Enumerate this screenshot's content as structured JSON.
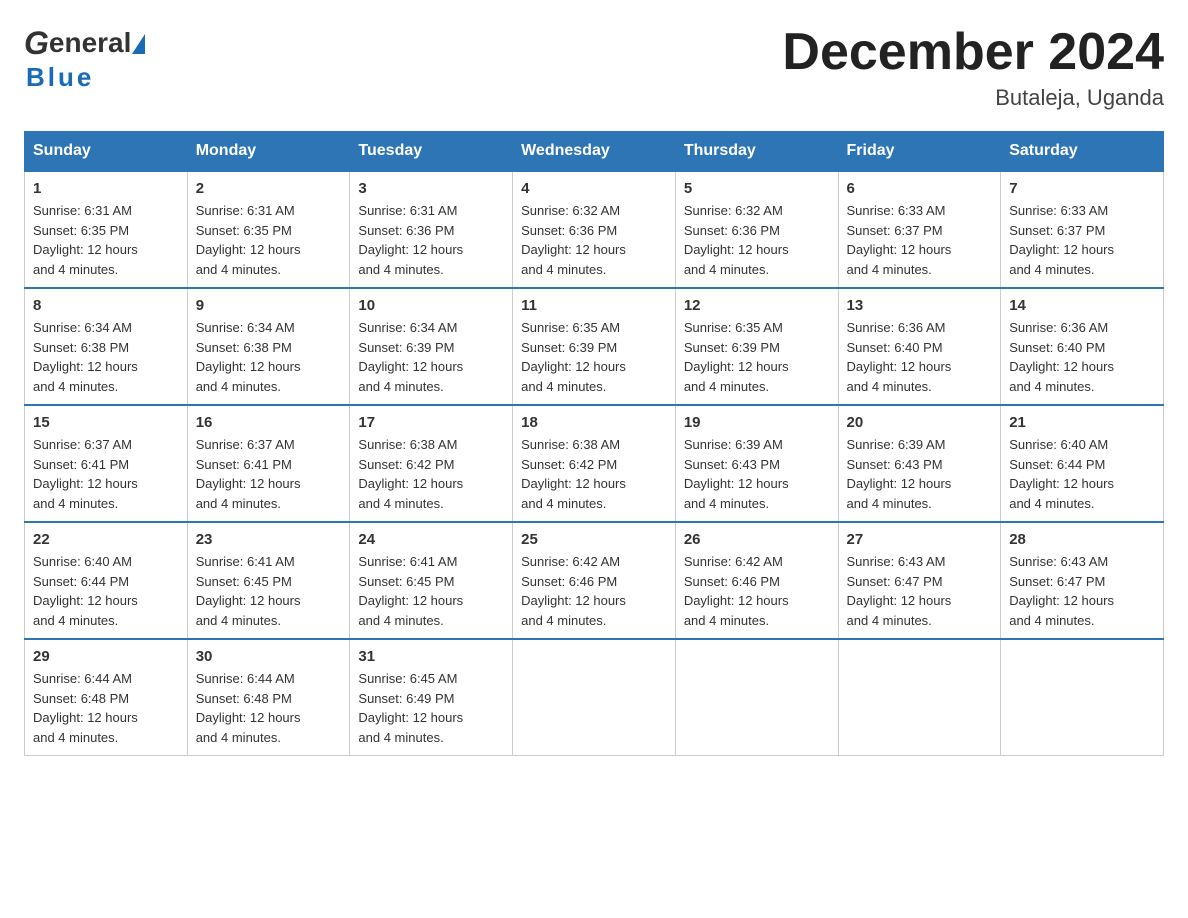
{
  "logo": {
    "line1": "General",
    "line2": "Blue"
  },
  "title": {
    "month_year": "December 2024",
    "location": "Butaleja, Uganda"
  },
  "days_of_week": [
    "Sunday",
    "Monday",
    "Tuesday",
    "Wednesday",
    "Thursday",
    "Friday",
    "Saturday"
  ],
  "weeks": [
    [
      {
        "day": "1",
        "sunrise": "6:31 AM",
        "sunset": "6:35 PM",
        "daylight": "12 hours and 4 minutes."
      },
      {
        "day": "2",
        "sunrise": "6:31 AM",
        "sunset": "6:35 PM",
        "daylight": "12 hours and 4 minutes."
      },
      {
        "day": "3",
        "sunrise": "6:31 AM",
        "sunset": "6:36 PM",
        "daylight": "12 hours and 4 minutes."
      },
      {
        "day": "4",
        "sunrise": "6:32 AM",
        "sunset": "6:36 PM",
        "daylight": "12 hours and 4 minutes."
      },
      {
        "day": "5",
        "sunrise": "6:32 AM",
        "sunset": "6:36 PM",
        "daylight": "12 hours and 4 minutes."
      },
      {
        "day": "6",
        "sunrise": "6:33 AM",
        "sunset": "6:37 PM",
        "daylight": "12 hours and 4 minutes."
      },
      {
        "day": "7",
        "sunrise": "6:33 AM",
        "sunset": "6:37 PM",
        "daylight": "12 hours and 4 minutes."
      }
    ],
    [
      {
        "day": "8",
        "sunrise": "6:34 AM",
        "sunset": "6:38 PM",
        "daylight": "12 hours and 4 minutes."
      },
      {
        "day": "9",
        "sunrise": "6:34 AM",
        "sunset": "6:38 PM",
        "daylight": "12 hours and 4 minutes."
      },
      {
        "day": "10",
        "sunrise": "6:34 AM",
        "sunset": "6:39 PM",
        "daylight": "12 hours and 4 minutes."
      },
      {
        "day": "11",
        "sunrise": "6:35 AM",
        "sunset": "6:39 PM",
        "daylight": "12 hours and 4 minutes."
      },
      {
        "day": "12",
        "sunrise": "6:35 AM",
        "sunset": "6:39 PM",
        "daylight": "12 hours and 4 minutes."
      },
      {
        "day": "13",
        "sunrise": "6:36 AM",
        "sunset": "6:40 PM",
        "daylight": "12 hours and 4 minutes."
      },
      {
        "day": "14",
        "sunrise": "6:36 AM",
        "sunset": "6:40 PM",
        "daylight": "12 hours and 4 minutes."
      }
    ],
    [
      {
        "day": "15",
        "sunrise": "6:37 AM",
        "sunset": "6:41 PM",
        "daylight": "12 hours and 4 minutes."
      },
      {
        "day": "16",
        "sunrise": "6:37 AM",
        "sunset": "6:41 PM",
        "daylight": "12 hours and 4 minutes."
      },
      {
        "day": "17",
        "sunrise": "6:38 AM",
        "sunset": "6:42 PM",
        "daylight": "12 hours and 4 minutes."
      },
      {
        "day": "18",
        "sunrise": "6:38 AM",
        "sunset": "6:42 PM",
        "daylight": "12 hours and 4 minutes."
      },
      {
        "day": "19",
        "sunrise": "6:39 AM",
        "sunset": "6:43 PM",
        "daylight": "12 hours and 4 minutes."
      },
      {
        "day": "20",
        "sunrise": "6:39 AM",
        "sunset": "6:43 PM",
        "daylight": "12 hours and 4 minutes."
      },
      {
        "day": "21",
        "sunrise": "6:40 AM",
        "sunset": "6:44 PM",
        "daylight": "12 hours and 4 minutes."
      }
    ],
    [
      {
        "day": "22",
        "sunrise": "6:40 AM",
        "sunset": "6:44 PM",
        "daylight": "12 hours and 4 minutes."
      },
      {
        "day": "23",
        "sunrise": "6:41 AM",
        "sunset": "6:45 PM",
        "daylight": "12 hours and 4 minutes."
      },
      {
        "day": "24",
        "sunrise": "6:41 AM",
        "sunset": "6:45 PM",
        "daylight": "12 hours and 4 minutes."
      },
      {
        "day": "25",
        "sunrise": "6:42 AM",
        "sunset": "6:46 PM",
        "daylight": "12 hours and 4 minutes."
      },
      {
        "day": "26",
        "sunrise": "6:42 AM",
        "sunset": "6:46 PM",
        "daylight": "12 hours and 4 minutes."
      },
      {
        "day": "27",
        "sunrise": "6:43 AM",
        "sunset": "6:47 PM",
        "daylight": "12 hours and 4 minutes."
      },
      {
        "day": "28",
        "sunrise": "6:43 AM",
        "sunset": "6:47 PM",
        "daylight": "12 hours and 4 minutes."
      }
    ],
    [
      {
        "day": "29",
        "sunrise": "6:44 AM",
        "sunset": "6:48 PM",
        "daylight": "12 hours and 4 minutes."
      },
      {
        "day": "30",
        "sunrise": "6:44 AM",
        "sunset": "6:48 PM",
        "daylight": "12 hours and 4 minutes."
      },
      {
        "day": "31",
        "sunrise": "6:45 AM",
        "sunset": "6:49 PM",
        "daylight": "12 hours and 4 minutes."
      },
      null,
      null,
      null,
      null
    ]
  ],
  "labels": {
    "sunrise": "Sunrise:",
    "sunset": "Sunset:",
    "daylight": "Daylight:"
  }
}
